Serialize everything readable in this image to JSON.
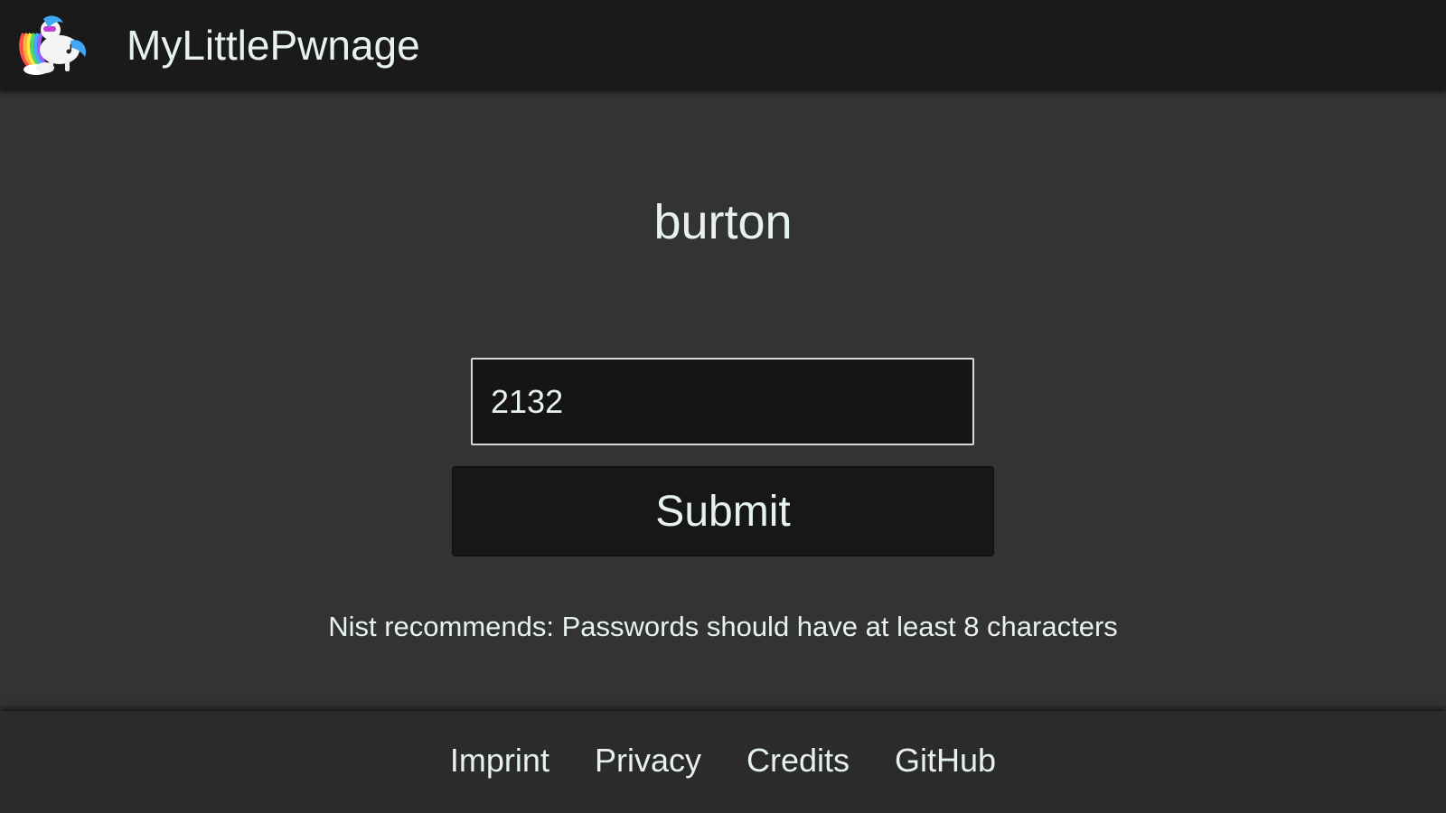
{
  "header": {
    "brand": "MyLittlePwnage",
    "logo_icon": "pony-logo-icon"
  },
  "main": {
    "title": "burton",
    "password_field": {
      "value": "2132",
      "placeholder": ""
    },
    "submit_label": "Submit",
    "hint": "Nist recommends: Passwords should have at least 8 characters"
  },
  "footer": {
    "links": [
      {
        "label": "Imprint"
      },
      {
        "label": "Privacy"
      },
      {
        "label": "Credits"
      },
      {
        "label": "GitHub"
      }
    ]
  },
  "colors": {
    "navbar_bg": "#1a1a1a",
    "page_bg": "#333333",
    "footer_bg": "#2b2b2b",
    "text": "#e8f1f2",
    "button_bg": "#171717"
  }
}
